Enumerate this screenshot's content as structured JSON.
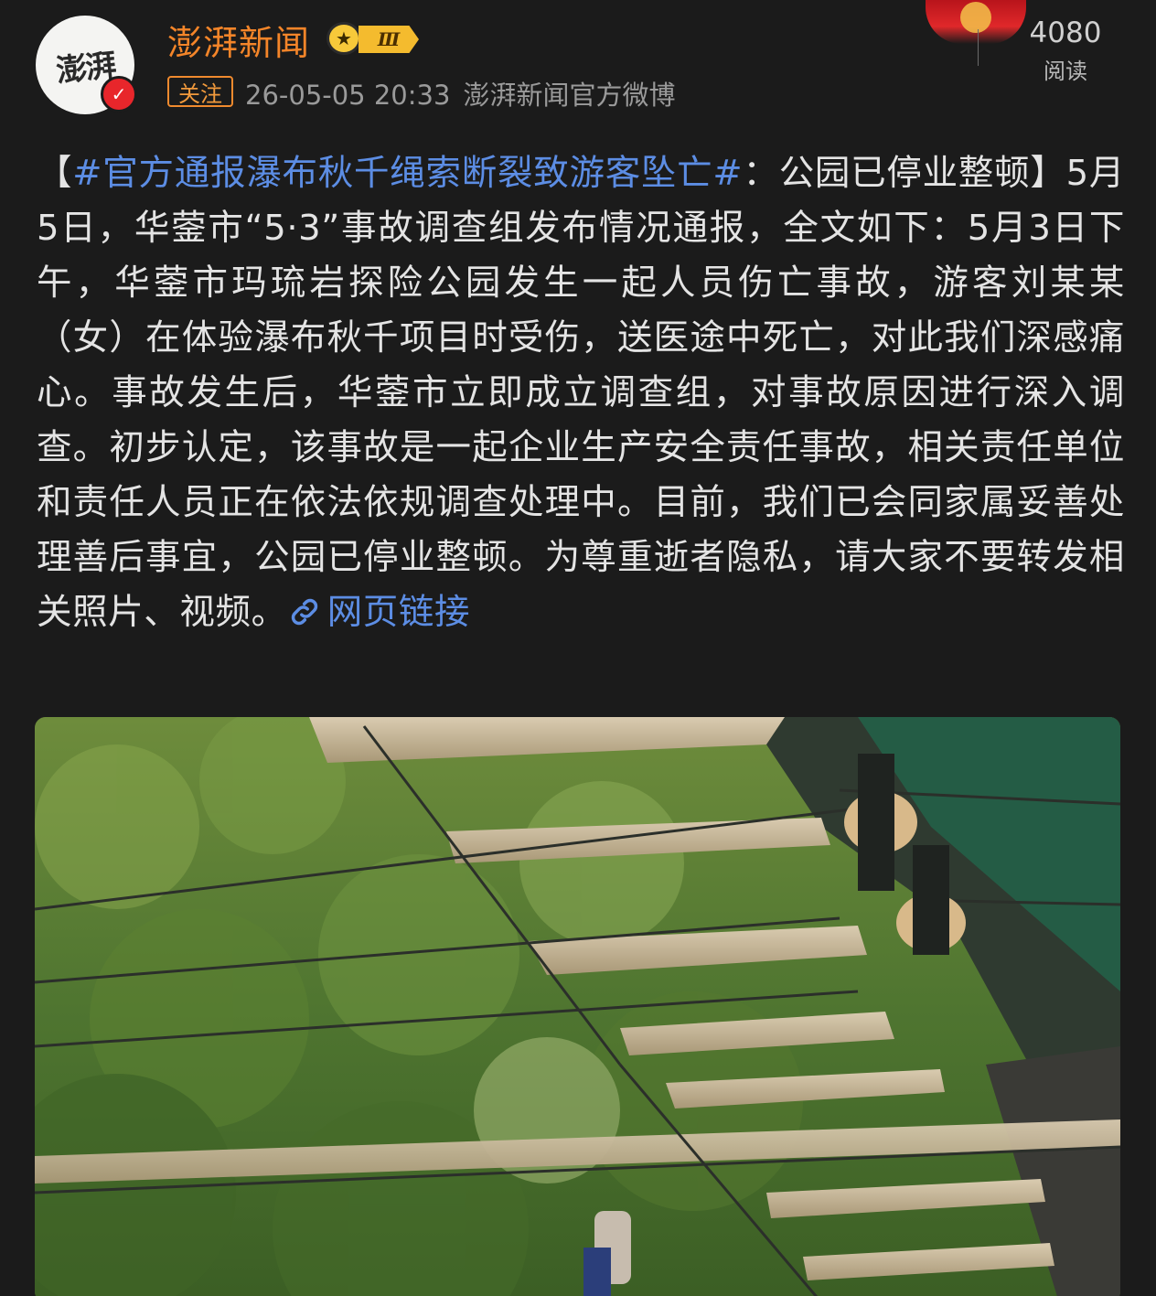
{
  "account": {
    "avatar_text": "澎湃",
    "name": "澎湃新闻",
    "level_badge": "Ⅲ",
    "follow_label": "关注",
    "timestamp": "26-05-05 20:33",
    "source": "澎湃新闻官方微博"
  },
  "stats": {
    "reads_count": "4080",
    "reads_label": "阅读"
  },
  "post": {
    "open_bracket": "【",
    "hashtag": "#官方通报瀑布秋千绳索断裂致游客坠亡#",
    "text": "：公园已停业整顿】5月5日，华蓥市“5·3”事故调查组发布情况通报，全文如下：5月3日下午，华蓥市玛琉岩探险公园发生一起人员伤亡事故，游客刘某某（女）在体验瀑布秋千项目时受伤，送医途中死亡，对此我们深感痛心。事故发生后，华蓥市立即成立调查组，对事故原因进行深入调查。初步认定，该事故是一起企业生产安全责任事故，相关责任单位和责任人员正在依法依规调查处理中。目前，我们已会同家属妥善处理善后事宜，公园已停业整顿。为尊重逝者隐私，请大家不要转发相关照片、视频。",
    "link_label": "网页链接"
  },
  "colors": {
    "background": "#1b1b1b",
    "name_orange": "#f48529",
    "link_blue": "#5c8de4",
    "verified_red": "#e8262b"
  },
  "icons": [
    "verified-icon",
    "crown-icon",
    "link-icon"
  ]
}
